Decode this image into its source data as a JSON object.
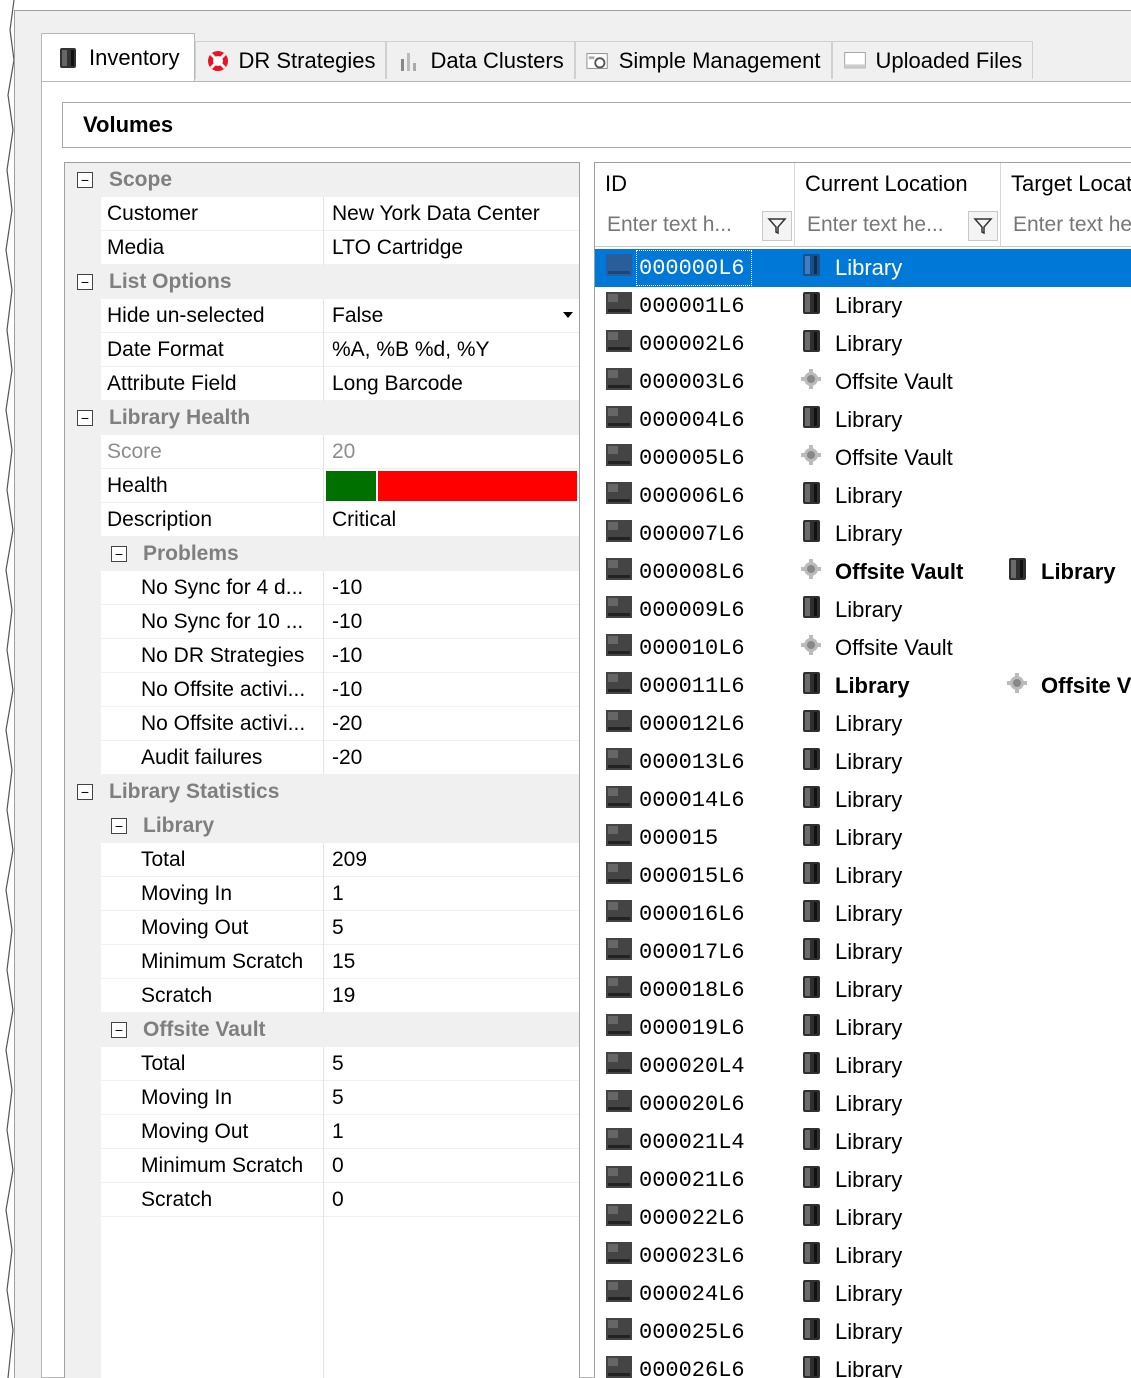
{
  "tabs": [
    {
      "label": "Inventory",
      "icon": "tape-icon",
      "active": true
    },
    {
      "label": "DR Strategies",
      "icon": "lifebuoy-icon",
      "active": false
    },
    {
      "label": "Data Clusters",
      "icon": "cluster-icon",
      "active": false
    },
    {
      "label": "Simple Management",
      "icon": "management-icon",
      "active": false
    },
    {
      "label": "Uploaded Files",
      "icon": "upload-icon",
      "active": false
    }
  ],
  "section_title": "Volumes",
  "properties": {
    "scope": {
      "label": "Scope",
      "rows": [
        {
          "name": "Customer",
          "value": "New York Data Center"
        },
        {
          "name": "Media",
          "value": "LTO Cartridge"
        }
      ]
    },
    "list_options": {
      "label": "List Options",
      "rows": [
        {
          "name": "Hide un-selected",
          "value": "False"
        },
        {
          "name": "Date Format",
          "value": "%A, %B %d, %Y"
        },
        {
          "name": "Attribute Field",
          "value": "Long Barcode"
        }
      ]
    },
    "library_health": {
      "label": "Library Health",
      "score_name": "Score",
      "score_value": "20",
      "health_name": "Health",
      "health_fraction": 0.2,
      "description_name": "Description",
      "description_value": "Critical"
    },
    "problems": {
      "label": "Problems",
      "rows": [
        {
          "name": "No Sync for 4 d...",
          "value": "-10"
        },
        {
          "name": "No Sync for 10 ...",
          "value": "-10"
        },
        {
          "name": "No DR Strategies",
          "value": "-10"
        },
        {
          "name": "No Offsite activi...",
          "value": "-10"
        },
        {
          "name": "No Offsite activi...",
          "value": "-20"
        },
        {
          "name": "Audit failures",
          "value": "-20"
        }
      ]
    },
    "library_statistics": {
      "label": "Library Statistics"
    },
    "library": {
      "label": "Library",
      "rows": [
        {
          "name": "Total",
          "value": "209"
        },
        {
          "name": "Moving In",
          "value": "1"
        },
        {
          "name": "Moving Out",
          "value": "5"
        },
        {
          "name": "Minimum Scratch",
          "value": "15"
        },
        {
          "name": "Scratch",
          "value": "19"
        }
      ]
    },
    "offsite_vault": {
      "label": "Offsite Vault",
      "rows": [
        {
          "name": "Total",
          "value": "5"
        },
        {
          "name": "Moving In",
          "value": "5"
        },
        {
          "name": "Moving Out",
          "value": "1"
        },
        {
          "name": "Minimum Scratch",
          "value": "0"
        },
        {
          "name": "Scratch",
          "value": "0"
        }
      ]
    }
  },
  "grid": {
    "columns": [
      {
        "label": "ID",
        "placeholder": "Enter text h..."
      },
      {
        "label": "Current Location",
        "placeholder": "Enter text he..."
      },
      {
        "label": "Target Locati",
        "placeholder": "Enter text he"
      }
    ],
    "rows": [
      {
        "id": "000000L6",
        "loc": "Library",
        "target": "",
        "selected": true
      },
      {
        "id": "000001L6",
        "loc": "Library",
        "target": ""
      },
      {
        "id": "000002L6",
        "loc": "Library",
        "target": ""
      },
      {
        "id": "000003L6",
        "loc": "Offsite Vault",
        "target": ""
      },
      {
        "id": "000004L6",
        "loc": "Library",
        "target": ""
      },
      {
        "id": "000005L6",
        "loc": "Offsite Vault",
        "target": ""
      },
      {
        "id": "000006L6",
        "loc": "Library",
        "target": ""
      },
      {
        "id": "000007L6",
        "loc": "Library",
        "target": ""
      },
      {
        "id": "000008L6",
        "loc": "Offsite Vault",
        "target": "Library",
        "bold": true
      },
      {
        "id": "000009L6",
        "loc": "Library",
        "target": ""
      },
      {
        "id": "000010L6",
        "loc": "Offsite Vault",
        "target": ""
      },
      {
        "id": "000011L6",
        "loc": "Library",
        "target": "Offsite V",
        "bold": true
      },
      {
        "id": "000012L6",
        "loc": "Library",
        "target": ""
      },
      {
        "id": "000013L6",
        "loc": "Library",
        "target": ""
      },
      {
        "id": "000014L6",
        "loc": "Library",
        "target": ""
      },
      {
        "id": "000015",
        "loc": "Library",
        "target": ""
      },
      {
        "id": "000015L6",
        "loc": "Library",
        "target": ""
      },
      {
        "id": "000016L6",
        "loc": "Library",
        "target": ""
      },
      {
        "id": "000017L6",
        "loc": "Library",
        "target": ""
      },
      {
        "id": "000018L6",
        "loc": "Library",
        "target": ""
      },
      {
        "id": "000019L6",
        "loc": "Library",
        "target": ""
      },
      {
        "id": "000020L4",
        "loc": "Library",
        "target": ""
      },
      {
        "id": "000020L6",
        "loc": "Library",
        "target": ""
      },
      {
        "id": "000021L4",
        "loc": "Library",
        "target": ""
      },
      {
        "id": "000021L6",
        "loc": "Library",
        "target": ""
      },
      {
        "id": "000022L6",
        "loc": "Library",
        "target": ""
      },
      {
        "id": "000023L6",
        "loc": "Library",
        "target": ""
      },
      {
        "id": "000024L6",
        "loc": "Library",
        "target": ""
      },
      {
        "id": "000025L6",
        "loc": "Library",
        "target": ""
      },
      {
        "id": "000026L6",
        "loc": "Library",
        "target": ""
      }
    ]
  },
  "colors": {
    "selection": "#0078d7",
    "health_good": "#007000",
    "health_bad": "#ff0000",
    "category_text": "#7f7f7f"
  }
}
